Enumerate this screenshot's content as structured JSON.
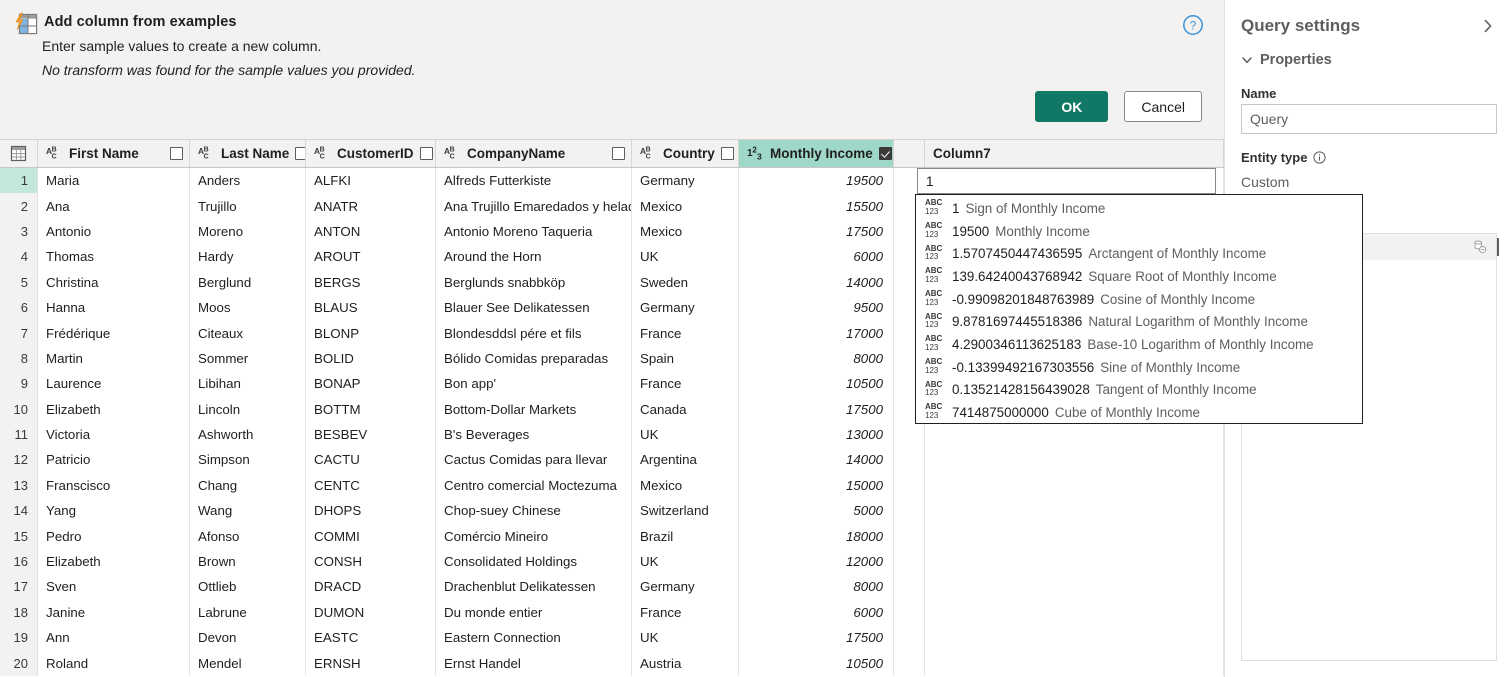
{
  "dialog": {
    "icon": "add-column-from-examples-icon",
    "title": "Add column from examples",
    "subtitle": "Enter sample values to create a new column.",
    "warning": "No transform was found for the sample values you provided.",
    "help_icon": "help-circle-icon",
    "ok_label": "OK",
    "cancel_label": "Cancel",
    "ok_color": "#117865"
  },
  "grid": {
    "corner_icon": "select-all-table-icon",
    "columns": [
      {
        "label": "First Name",
        "type_icon": "abc-text-type-icon",
        "checked": false,
        "numeric": false,
        "selected": false
      },
      {
        "label": "Last Name",
        "type_icon": "abc-text-type-icon",
        "checked": false,
        "numeric": false,
        "selected": false
      },
      {
        "label": "CustomerID",
        "type_icon": "abc-text-type-icon",
        "checked": false,
        "numeric": false,
        "selected": false
      },
      {
        "label": "CompanyName",
        "type_icon": "abc-text-type-icon",
        "checked": false,
        "numeric": false,
        "selected": false
      },
      {
        "label": "Country",
        "type_icon": "abc-text-type-icon",
        "checked": false,
        "numeric": false,
        "selected": false
      },
      {
        "label": "Monthly Income",
        "type_icon": "123-number-type-icon",
        "checked": true,
        "numeric": true,
        "selected": true
      }
    ],
    "new_column": {
      "header": "Column7",
      "input_value": "1"
    },
    "rows": [
      {
        "n": "1",
        "first": "Maria",
        "last": "Anders",
        "id": "ALFKI",
        "company": "Alfreds Futterkiste",
        "country": "Germany",
        "income": "19500",
        "active": true
      },
      {
        "n": "2",
        "first": "Ana",
        "last": "Trujillo",
        "id": "ANATR",
        "company": "Ana Trujillo Emaredados y helados",
        "country": "Mexico",
        "income": "15500",
        "active": false
      },
      {
        "n": "3",
        "first": "Antonio",
        "last": "Moreno",
        "id": "ANTON",
        "company": "Antonio Moreno Taqueria",
        "country": "Mexico",
        "income": "17500",
        "active": false
      },
      {
        "n": "4",
        "first": "Thomas",
        "last": "Hardy",
        "id": "AROUT",
        "company": "Around the Horn",
        "country": "UK",
        "income": "6000",
        "active": false
      },
      {
        "n": "5",
        "first": "Christina",
        "last": "Berglund",
        "id": "BERGS",
        "company": "Berglunds snabbköp",
        "country": "Sweden",
        "income": "14000",
        "active": false
      },
      {
        "n": "6",
        "first": "Hanna",
        "last": "Moos",
        "id": "BLAUS",
        "company": "Blauer See Delikatessen",
        "country": "Germany",
        "income": "9500",
        "active": false
      },
      {
        "n": "7",
        "first": "Frédérique",
        "last": "Citeaux",
        "id": "BLONP",
        "company": "Blondesddsl pére et fils",
        "country": "France",
        "income": "17000",
        "active": false
      },
      {
        "n": "8",
        "first": "Martin",
        "last": "Sommer",
        "id": "BOLID",
        "company": "Bólido Comidas preparadas",
        "country": "Spain",
        "income": "8000",
        "active": false
      },
      {
        "n": "9",
        "first": "Laurence",
        "last": "Libihan",
        "id": "BONAP",
        "company": "Bon app'",
        "country": "France",
        "income": "10500",
        "active": false
      },
      {
        "n": "10",
        "first": "Elizabeth",
        "last": "Lincoln",
        "id": "BOTTM",
        "company": "Bottom-Dollar Markets",
        "country": "Canada",
        "income": "17500",
        "active": false
      },
      {
        "n": "11",
        "first": "Victoria",
        "last": "Ashworth",
        "id": "BESBEV",
        "company": "B's Beverages",
        "country": "UK",
        "income": "13000",
        "active": false
      },
      {
        "n": "12",
        "first": "Patricio",
        "last": "Simpson",
        "id": "CACTU",
        "company": "Cactus Comidas para llevar",
        "country": "Argentina",
        "income": "14000",
        "active": false
      },
      {
        "n": "13",
        "first": "Franscisco",
        "last": "Chang",
        "id": "CENTC",
        "company": "Centro comercial Moctezuma",
        "country": "Mexico",
        "income": "15000",
        "active": false
      },
      {
        "n": "14",
        "first": "Yang",
        "last": "Wang",
        "id": "DHOPS",
        "company": "Chop-suey Chinese",
        "country": "Switzerland",
        "income": "5000",
        "active": false
      },
      {
        "n": "15",
        "first": "Pedro",
        "last": "Afonso",
        "id": "COMMI",
        "company": "Comércio Mineiro",
        "country": "Brazil",
        "income": "18000",
        "active": false
      },
      {
        "n": "16",
        "first": "Elizabeth",
        "last": "Brown",
        "id": "CONSH",
        "company": "Consolidated Holdings",
        "country": "UK",
        "income": "12000",
        "active": false
      },
      {
        "n": "17",
        "first": "Sven",
        "last": "Ottlieb",
        "id": "DRACD",
        "company": "Drachenblut Delikatessen",
        "country": "Germany",
        "income": "8000",
        "active": false
      },
      {
        "n": "18",
        "first": "Janine",
        "last": "Labrune",
        "id": "DUMON",
        "company": "Du monde entier",
        "country": "France",
        "income": "6000",
        "active": false
      },
      {
        "n": "19",
        "first": "Ann",
        "last": "Devon",
        "id": "EASTC",
        "company": "Eastern Connection",
        "country": "UK",
        "income": "17500",
        "active": false
      },
      {
        "n": "20",
        "first": "Roland",
        "last": "Mendel",
        "id": "ERNSH",
        "company": "Ernst Handel",
        "country": "Austria",
        "income": "10500",
        "active": false
      }
    ]
  },
  "suggestions": {
    "icon": "abc-123-any-type-icon",
    "items": [
      {
        "value": "1",
        "label": "Sign of Monthly Income"
      },
      {
        "value": "19500",
        "label": "Monthly Income"
      },
      {
        "value": "1.5707450447436595",
        "label": "Arctangent of Monthly Income"
      },
      {
        "value": "139.64240043768942",
        "label": "Square Root of Monthly Income"
      },
      {
        "value": "-0.99098201848763989",
        "label": "Cosine of Monthly Income"
      },
      {
        "value": "9.8781697445518386",
        "label": "Natural Logarithm of Monthly Income"
      },
      {
        "value": "4.2900346113625183",
        "label": "Base-10 Logarithm of Monthly Income"
      },
      {
        "value": "-0.13399492167303556",
        "label": "Sine of Monthly Income"
      },
      {
        "value": "0.13521428156439028",
        "label": "Tangent of Monthly Income"
      },
      {
        "value": "7414875000000",
        "label": "Cube of Monthly Income"
      }
    ]
  },
  "query_settings": {
    "title": "Query settings",
    "collapse_icon": "chevron-right-icon",
    "properties_label": "Properties",
    "properties_chevron": "chevron-down-icon",
    "name_label": "Name",
    "name_value": "Query",
    "entity_type_label": "Entity type",
    "entity_type_info_icon": "info-circle-icon",
    "entity_type_value": "Custom",
    "steps_icon": "database-source-icon"
  }
}
